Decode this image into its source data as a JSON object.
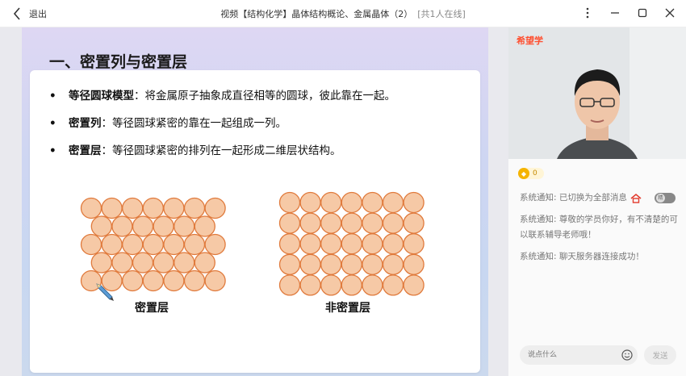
{
  "titlebar": {
    "back_label": "退出",
    "title": "视频【结构化学】晶体结构概论、金属晶体（2）",
    "online": "[共1人在线]"
  },
  "slide": {
    "title": "一、密置列与密置层",
    "bullets": [
      {
        "term": "等径圆球模型",
        "text": "：将金属原子抽象成直径相等的圆球，彼此靠在一起。"
      },
      {
        "term": "密置列",
        "text": "：等径圆球紧密的靠在一起组成一列。"
      },
      {
        "term": "密置层",
        "text": "：等径圆球紧密的排列在一起形成二维层状结构。"
      }
    ],
    "dense_caption": "密置层",
    "nondense_caption": "非密置层",
    "circle_fill": "#f6c9a6",
    "circle_stroke": "#e07a3c"
  },
  "panel": {
    "brand": "希望学",
    "coin_count": "0",
    "messages": [
      "系统通知: 已切换为全部消息",
      "系统通知: 尊敬的学员你好，有不清楚的可以联系辅导老师哦！",
      "系统通知: 聊天服务器连接成功！"
    ],
    "toggle_label": "精",
    "input_placeholder": "说点什么",
    "send_label": "发送"
  }
}
